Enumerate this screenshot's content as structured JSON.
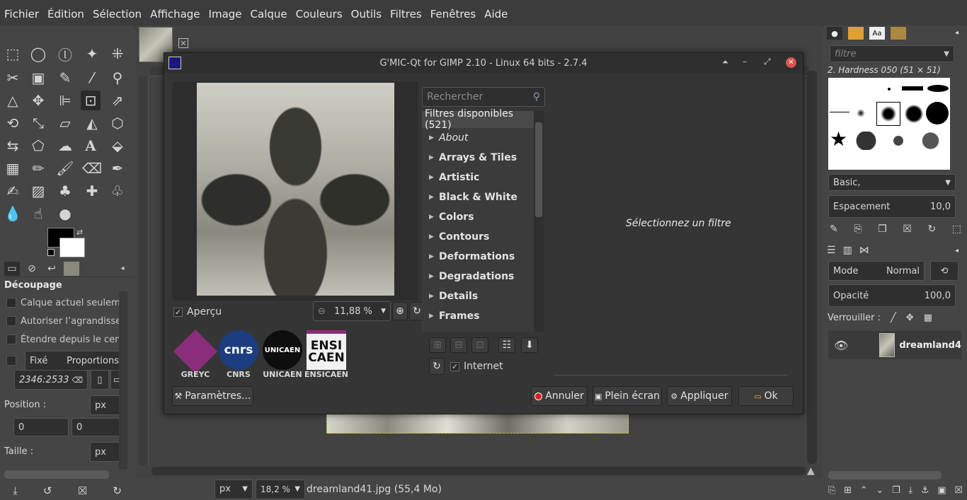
{
  "menubar": [
    "Fichier",
    "Édition",
    "Sélection",
    "Affichage",
    "Image",
    "Calque",
    "Couleurs",
    "Outils",
    "Filtres",
    "Fenêtres",
    "Aide"
  ],
  "tool_options": {
    "title": "Découpage",
    "checkboxes": [
      "Calque actuel seulement",
      "Autoriser l’agrandissement",
      "Étendre depuis le centre"
    ],
    "fixed_label": "Fixé",
    "fixed_value": "Proportions",
    "ratio_value": "2346:2533",
    "position_label": "Position :",
    "position_unit": "px",
    "position_x": "0",
    "position_y": "0",
    "size_label": "Taille :",
    "size_unit": "px"
  },
  "statusbar": {
    "unit": "px",
    "zoom": "18,2 %",
    "file_info": "dreamland41.jpg (55,4 Mo)"
  },
  "right_dock": {
    "filter_placeholder": "filtre",
    "brush_name": "2. Hardness 050 (51 × 51)",
    "brush_set": "Basic,",
    "spacing_label": "Espacement",
    "spacing_value": "10,0",
    "mode_label": "Mode",
    "mode_value": "Normal",
    "opacity_label": "Opacité",
    "opacity_value": "100,0",
    "lock_label": "Verrouiller :",
    "layer_name": "dreamland4"
  },
  "dialog": {
    "title": "G'MIC-Qt for GIMP 2.10 - Linux 64 bits - 2.7.4",
    "preview_label": "Aperçu",
    "zoom_value": "11,88 %",
    "search_placeholder": "Rechercher",
    "filters_header": "Filtres disponibles (521)",
    "filters": [
      "About",
      "Arrays & Tiles",
      "Artistic",
      "Black & White",
      "Colors",
      "Contours",
      "Deformations",
      "Degradations",
      "Details",
      "Frames"
    ],
    "internet_label": "Internet",
    "select_filter_msg": "Sélectionnez un filtre",
    "logos": [
      "GREYC",
      "CNRS",
      "UNICAEN",
      "ENSICAEN"
    ],
    "logo_texts": {
      "cnrs": "cnrs",
      "unicaen": "UNICAEN",
      "ensicaen_1": "ENSI",
      "ensicaen_2": "CAEN"
    },
    "buttons": {
      "params": "Paramètres...",
      "cancel": "Annuler",
      "fullscreen": "Plein écran",
      "apply": "Appliquer",
      "ok": "Ok"
    }
  },
  "colors": {
    "accent_close": "#d9534f",
    "logo_greyc": "#8a2d7a",
    "logo_cnrs": "#1c3d80"
  }
}
